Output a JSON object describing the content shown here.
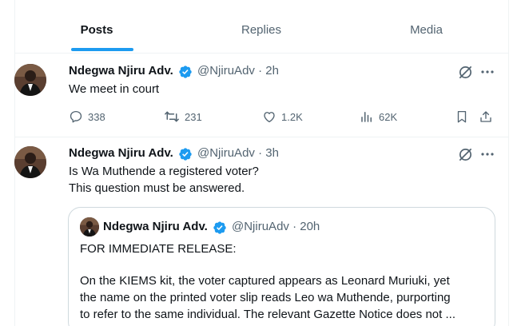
{
  "tabs": [
    {
      "label": "Posts",
      "active": true
    },
    {
      "label": "Replies",
      "active": false
    },
    {
      "label": "Media",
      "active": false
    }
  ],
  "colors": {
    "accent": "#1d9bf0",
    "secondary_text": "#536471",
    "border": "#eff3f4"
  },
  "tweets": [
    {
      "author": "Ndegwa Njiru Adv.",
      "handle_time": "@NjiruAdv · 2h",
      "text_lines": [
        "We meet in court"
      ],
      "replies": "338",
      "reposts": "231",
      "likes": "1.2K",
      "views": "62K"
    },
    {
      "author": "Ndegwa Njiru Adv.",
      "handle_time": "@NjiruAdv · 3h",
      "text_lines": [
        "Is Wa Muthende a registered voter?",
        "This question must be answered."
      ],
      "quote": {
        "author": "Ndegwa Njiru Adv.",
        "handle_time": "@NjiruAdv · 20h",
        "text_lines": [
          "FOR IMMEDIATE RELEASE:",
          "",
          "On the KIEMS kit, the voter captured appears as Leonard Muriuki, yet",
          "the name on the printed voter slip reads Leo wa Muthende, purporting",
          "to refer to the same individual. The relevant Gazette Notice does not ..."
        ]
      }
    }
  ],
  "icons": {
    "verified": "verified-badge-icon",
    "grok": "grok-icon",
    "more": "more-icon",
    "reply": "reply-icon",
    "repost": "repost-icon",
    "like": "like-icon",
    "views": "views-icon",
    "bookmark": "bookmark-icon",
    "share": "share-icon"
  }
}
